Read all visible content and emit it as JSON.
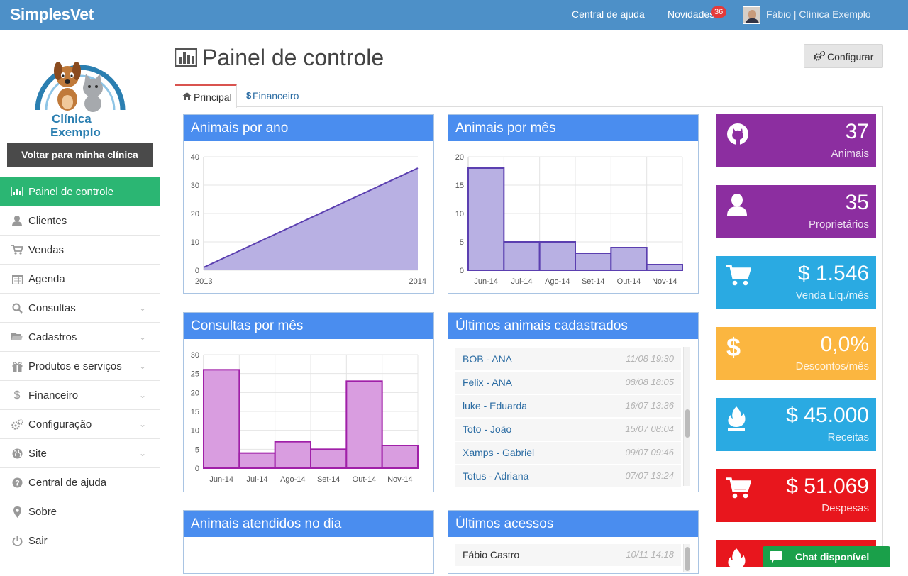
{
  "topbar": {
    "brand": "SimplesVet",
    "help": "Central de ajuda",
    "news": "Novidades",
    "news_count": "36",
    "user": "Fábio | Clínica Exemplo"
  },
  "sidebar": {
    "logo_line1": "Clínica",
    "logo_line2": "Exemplo",
    "back_button": "Voltar para minha clínica",
    "items": [
      {
        "label": "Painel de controle",
        "icon": "bar-chart-icon",
        "active": true
      },
      {
        "label": "Clientes",
        "icon": "user-icon"
      },
      {
        "label": "Vendas",
        "icon": "cart-icon"
      },
      {
        "label": "Agenda",
        "icon": "calendar-icon"
      },
      {
        "label": "Consultas",
        "icon": "search-icon",
        "expandable": true
      },
      {
        "label": "Cadastros",
        "icon": "folder-icon",
        "expandable": true
      },
      {
        "label": "Produtos e serviços",
        "icon": "gift-icon",
        "expandable": true
      },
      {
        "label": "Financeiro",
        "icon": "dollar-icon",
        "expandable": true
      },
      {
        "label": "Configuração",
        "icon": "gears-icon",
        "expandable": true
      },
      {
        "label": "Site",
        "icon": "globe-icon",
        "expandable": true
      },
      {
        "label": "Central de ajuda",
        "icon": "question-icon"
      },
      {
        "label": "Sobre",
        "icon": "map-marker-icon"
      },
      {
        "label": "Sair",
        "icon": "power-icon"
      }
    ]
  },
  "main": {
    "title": "Painel de controle",
    "config_button": "Configurar",
    "tabs": [
      {
        "label": "Principal",
        "icon": "home-icon",
        "active": true
      },
      {
        "label": "Financeiro",
        "icon": "dollar-icon"
      }
    ]
  },
  "panels": {
    "animais_ano": "Animais por ano",
    "animais_mes": "Animais por mês",
    "consultas_mes": "Consultas por mês",
    "ultimos_animais": "Últimos animais cadastrados",
    "atendidos_dia": "Animais atendidos no dia",
    "ultimos_acessos": "Últimos acessos"
  },
  "chart_data": [
    {
      "type": "area",
      "title": "Animais por ano",
      "x": [
        "2013",
        "2014"
      ],
      "values": [
        1,
        36
      ],
      "ylim": [
        0,
        40
      ],
      "yticks": [
        0,
        10,
        20,
        30,
        40
      ],
      "color": "#b8b0e3",
      "line_color": "#5b3fb0"
    },
    {
      "type": "bar",
      "title": "Animais por mês",
      "categories": [
        "Jun-14",
        "Jul-14",
        "Ago-14",
        "Set-14",
        "Out-14",
        "Nov-14"
      ],
      "values": [
        18,
        5,
        5,
        3,
        4,
        1
      ],
      "ylim": [
        0,
        20
      ],
      "yticks": [
        0,
        5,
        10,
        15,
        20
      ],
      "color": "#b8b0e3",
      "line_color": "#5b3fb0"
    },
    {
      "type": "bar",
      "title": "Consultas por mês",
      "categories": [
        "Jun-14",
        "Jul-14",
        "Ago-14",
        "Set-14",
        "Out-14",
        "Nov-14"
      ],
      "values": [
        26,
        4,
        7,
        5,
        23,
        6
      ],
      "ylim": [
        0,
        30
      ],
      "yticks": [
        0,
        5,
        10,
        15,
        20,
        25,
        30
      ],
      "color": "#d99de0",
      "line_color": "#a020a8"
    }
  ],
  "ultimos_animais": [
    {
      "name": "BOB - ANA",
      "time": "11/08 19:30"
    },
    {
      "name": "Felix - ANA",
      "time": "08/08 18:05"
    },
    {
      "name": "luke - Eduarda",
      "time": "16/07 13:36"
    },
    {
      "name": "Toto - João",
      "time": "15/07 08:04"
    },
    {
      "name": "Xamps - Gabriel",
      "time": "09/07 09:46"
    },
    {
      "name": "Totus - Adriana",
      "time": "07/07 13:24"
    }
  ],
  "ultimos_acessos": [
    {
      "name": "Fábio Castro",
      "time": "10/11 14:18"
    }
  ],
  "stats": [
    {
      "value": "37",
      "label": "Animais",
      "icon": "github-icon",
      "color": "#8c2ea0"
    },
    {
      "value": "35",
      "label": "Proprietários",
      "icon": "user-icon",
      "color": "#8c2ea0"
    },
    {
      "value": "$ 1.546",
      "label": "Venda Liq./mês",
      "icon": "cart-icon",
      "color": "#2aaae2"
    },
    {
      "value": "0,0%",
      "label": "Descontos/mês",
      "icon": "dollar-icon",
      "color": "#fbb640"
    },
    {
      "value": "$ 45.000",
      "label": "Receitas",
      "icon": "fire-icon",
      "color": "#2aaae2"
    },
    {
      "value": "$ 51.069",
      "label": "Despesas",
      "icon": "cart-icon",
      "color": "#e8161d"
    },
    {
      "value": "",
      "label": "",
      "icon": "fire-icon",
      "color": "#e8161d"
    }
  ],
  "chat": {
    "label": "Chat disponível"
  }
}
